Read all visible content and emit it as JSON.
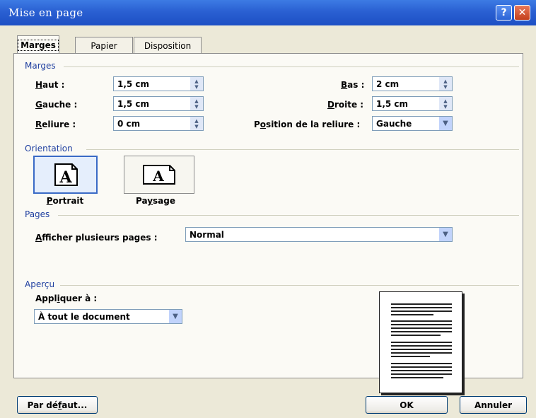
{
  "window": {
    "title": "Mise en page",
    "help_icon": "?",
    "close_icon": "✕"
  },
  "tabs": [
    "Marges",
    "Papier",
    "Disposition"
  ],
  "marges": {
    "group_label": "Marges",
    "haut": {
      "label_u": "H",
      "label_rest": "aut :",
      "value": "1,5 cm"
    },
    "gauche": {
      "label_u": "G",
      "label_rest": "auche :",
      "value": "1,5 cm"
    },
    "reliure": {
      "label_u": "R",
      "label_rest": "eliure :",
      "value": "0 cm"
    },
    "bas": {
      "label_u": "B",
      "label_rest": "as :",
      "value": "2 cm"
    },
    "droite": {
      "label_u": "D",
      "label_rest": "roite :",
      "value": "1,5 cm"
    },
    "position_reliure": {
      "label_pre": "P",
      "label_u": "o",
      "label_rest": "sition de la reliure :",
      "value": "Gauche"
    }
  },
  "orientation": {
    "group_label": "Orientation",
    "portrait": {
      "label_u": "P",
      "label_rest": "ortrait",
      "selected": true
    },
    "paysage": {
      "label_pre": "Pa",
      "label_u": "y",
      "label_rest": "sage",
      "selected": false
    },
    "glyph": "A"
  },
  "pages": {
    "group_label": "Pages",
    "afficher_label_u": "A",
    "afficher_label_rest": "fficher plusieurs pages :",
    "afficher_value": "Normal"
  },
  "apercu": {
    "group_label": "Aperçu",
    "appliquer_pre": "Appl",
    "appliquer_u": "i",
    "appliquer_rest": "quer à :",
    "appliquer_value": "À tout le document"
  },
  "buttons": {
    "default_pre": "Par dé",
    "default_u": "f",
    "default_rest": "aut...",
    "ok": "OK",
    "cancel": "Annuler"
  },
  "colors": {
    "titlebar": "#2a60d2",
    "dialog_bg": "#ece9d8",
    "group_label": "#1f3fa0"
  }
}
